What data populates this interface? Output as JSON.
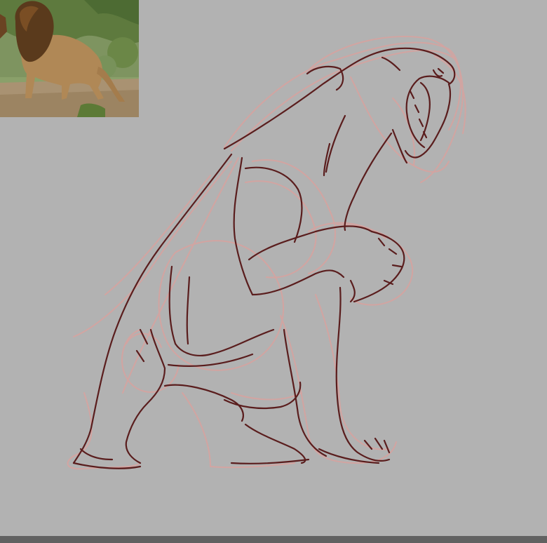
{
  "canvas": {
    "background_color": "#b2b2b2"
  },
  "reference_photo": {
    "subject": "lion-walking-in-savanna",
    "colors": {
      "foliage": "#6f8a4a",
      "ground": "#a08a6a",
      "mane": "#5a3a1c",
      "fur": "#b08856"
    }
  },
  "sketch": {
    "subject": "roaring-lioness-sketch",
    "colors": {
      "construction_lines": "#d6a3a0",
      "line_art": "#5a1d1d"
    }
  },
  "status_bar": {
    "color": "#616161"
  }
}
